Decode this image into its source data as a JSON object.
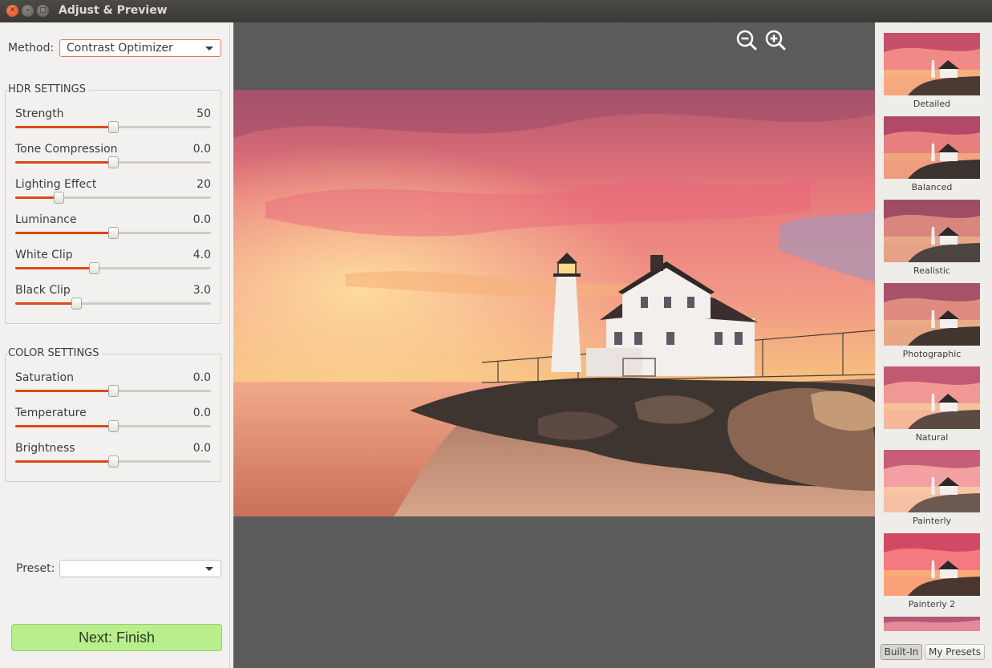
{
  "window": {
    "title": "Adjust & Preview"
  },
  "method": {
    "label": "Method:",
    "value": "Contrast Optimizer"
  },
  "hdr_settings": {
    "title": "HDR SETTINGS",
    "sliders": [
      {
        "label": "Strength",
        "value": "50",
        "level": 0.5
      },
      {
        "label": "Tone Compression",
        "value": "0.0",
        "level": 0.5
      },
      {
        "label": "Lighting Effect",
        "value": "20",
        "level": 0.22
      },
      {
        "label": "Luminance",
        "value": "0.0",
        "level": 0.5
      },
      {
        "label": "White Clip",
        "value": "4.0",
        "level": 0.4
      },
      {
        "label": "Black Clip",
        "value": "3.0",
        "level": 0.31
      }
    ]
  },
  "color_settings": {
    "title": "COLOR SETTINGS",
    "sliders": [
      {
        "label": "Saturation",
        "value": "0.0",
        "level": 0.5
      },
      {
        "label": "Temperature",
        "value": "0.0",
        "level": 0.5
      },
      {
        "label": "Brightness",
        "value": "0.0",
        "level": 0.5
      }
    ]
  },
  "preset": {
    "label": "Preset:",
    "value": ""
  },
  "next_button": "Next: Finish",
  "presets": {
    "items": [
      "Detailed",
      "Balanced",
      "Realistic",
      "Photographic",
      "Natural",
      "Painterly",
      "Painterly 2"
    ],
    "tabs": {
      "builtin": "Built-In",
      "mine": "My Presets"
    }
  },
  "colors": {
    "accent": "#dd4814",
    "next_button": "#b9ee8d",
    "preview_bg": "#5b5b5b"
  }
}
